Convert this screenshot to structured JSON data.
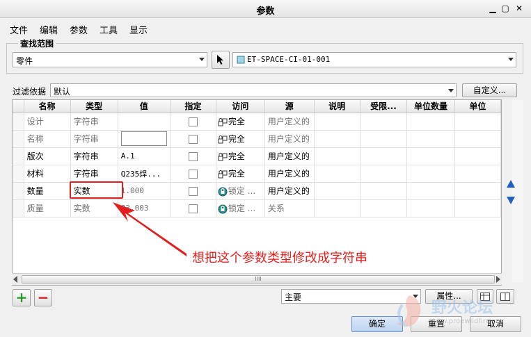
{
  "window": {
    "title": "参数",
    "minimize_symbol": "▁",
    "maximize_symbol": "▢",
    "close_symbol": "✕"
  },
  "menu": [
    "文件",
    "编辑",
    "参数",
    "工具",
    "显示"
  ],
  "search_scope": {
    "label": "查找范围",
    "scope_value": "零件",
    "model_value": "ET-SPACE-CI-01-001"
  },
  "filter": {
    "label": "过滤依据",
    "value": "默认",
    "custom_button": "自定义..."
  },
  "table": {
    "headers": [
      "名称",
      "类型",
      "值",
      "指定",
      "访问",
      "源",
      "说明",
      "受限...",
      "单位数量",
      "单位"
    ],
    "rows": [
      {
        "name": "设计",
        "type": "字符串",
        "value": "",
        "designated": false,
        "access": "完全",
        "source": "用户定义的",
        "locked": false,
        "gray": true
      },
      {
        "name": "名称",
        "type": "字符串",
        "value": "",
        "designated": false,
        "access": "完全",
        "source": "用户定义的",
        "locked": false,
        "gray": true,
        "editing": true
      },
      {
        "name": "版次",
        "type": "字符串",
        "value": "A.1",
        "designated": false,
        "access": "完全",
        "source": "用户定义的",
        "locked": false,
        "gray": false
      },
      {
        "name": "材料",
        "type": "字符串",
        "value": "Q235焊...",
        "designated": false,
        "access": "完全",
        "source": "用户定义的",
        "locked": false,
        "gray": false
      },
      {
        "name": "数量",
        "type": "实数",
        "value": "1.000",
        "designated": false,
        "access": "锁定 ...",
        "source": "用户定义的",
        "locked": true,
        "gray": false
      },
      {
        "name": "质量",
        "type": "实数",
        "value": "83.003",
        "designated": false,
        "access": "锁定 ...",
        "source": "关系",
        "locked": true,
        "gray": true
      }
    ]
  },
  "annotation": "想把这个参数类型修改成字符串",
  "bottom": {
    "add_symbol": "+",
    "remove_symbol": "−",
    "scroll_grip": "IIII",
    "category_value": "主要",
    "properties_button": "属性...",
    "ok_button": "确定",
    "reset_button": "重置",
    "cancel_button": "取消"
  },
  "watermark": {
    "text": "野火论坛",
    "url": "www.proewildfire.cn"
  },
  "colors": {
    "annotation": "#e0201e",
    "selected_button": "#cfe0f5",
    "arrow_blue": "#1e5fc0",
    "add_green": "#2a9a2a",
    "remove_red": "#d02020"
  }
}
